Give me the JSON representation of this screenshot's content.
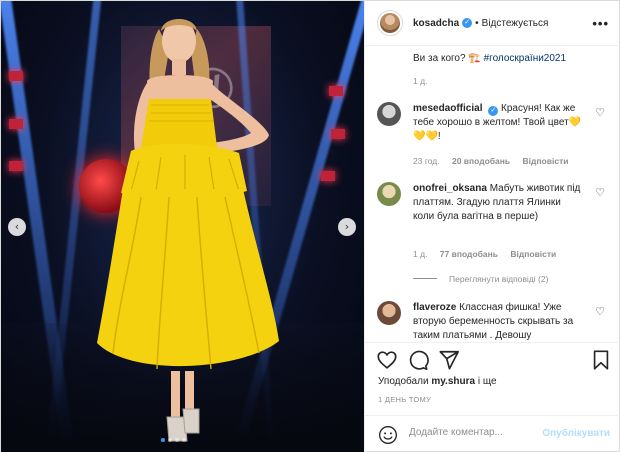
{
  "header": {
    "username": "kosadcha",
    "separator": "•",
    "follow_label": "Відстежується",
    "more_label": "•••"
  },
  "caption": {
    "text": "Ви за кого? 🏗️ ",
    "hashtag": "#голоскраїни2021",
    "age": "1 д."
  },
  "comments": [
    {
      "username": "mesedaofficial",
      "verified": true,
      "text": "Красуня! Как же тебе хорошо в желтом! Твой цвет💛💛💛!",
      "age": "23 год.",
      "likes": "20 вподобань",
      "reply_label": "Відповісти"
    },
    {
      "username": "onofrei_oksana",
      "verified": false,
      "text": "Мабуть животик під платтям. Згадую плаття Ялинки коли була вагітна в перше)",
      "age": "1 д.",
      "likes": "77 вподобань",
      "reply_label": "Відповісти"
    },
    {
      "username": "flaveroze",
      "verified": false,
      "text": "Классная фишка! Уже вторую беременность скрывать за таким платьями . Девошу"
    }
  ],
  "view_replies_label": "Переглянути відповіді (2)",
  "likes_line": {
    "prefix": "Уподобали",
    "user": "my.shura",
    "suffix": "і ще"
  },
  "timestamp": "1 ДЕНЬ ТОМУ",
  "comment_box": {
    "placeholder": "Додайте коментар...",
    "post_label": "Опублікувати"
  },
  "carousel": {
    "prev_glyph": "‹",
    "next_glyph": "›",
    "slide_count": 4,
    "active_index": 0
  },
  "colors": {
    "verified_blue": "#3897f0",
    "dress_yellow": "#f5d20f",
    "post_button_disabled": "#b2dffc"
  },
  "icons": [
    "heart-icon",
    "comment-icon",
    "share-icon",
    "bookmark-icon",
    "smiley-icon",
    "verified-icon",
    "more-icon"
  ]
}
